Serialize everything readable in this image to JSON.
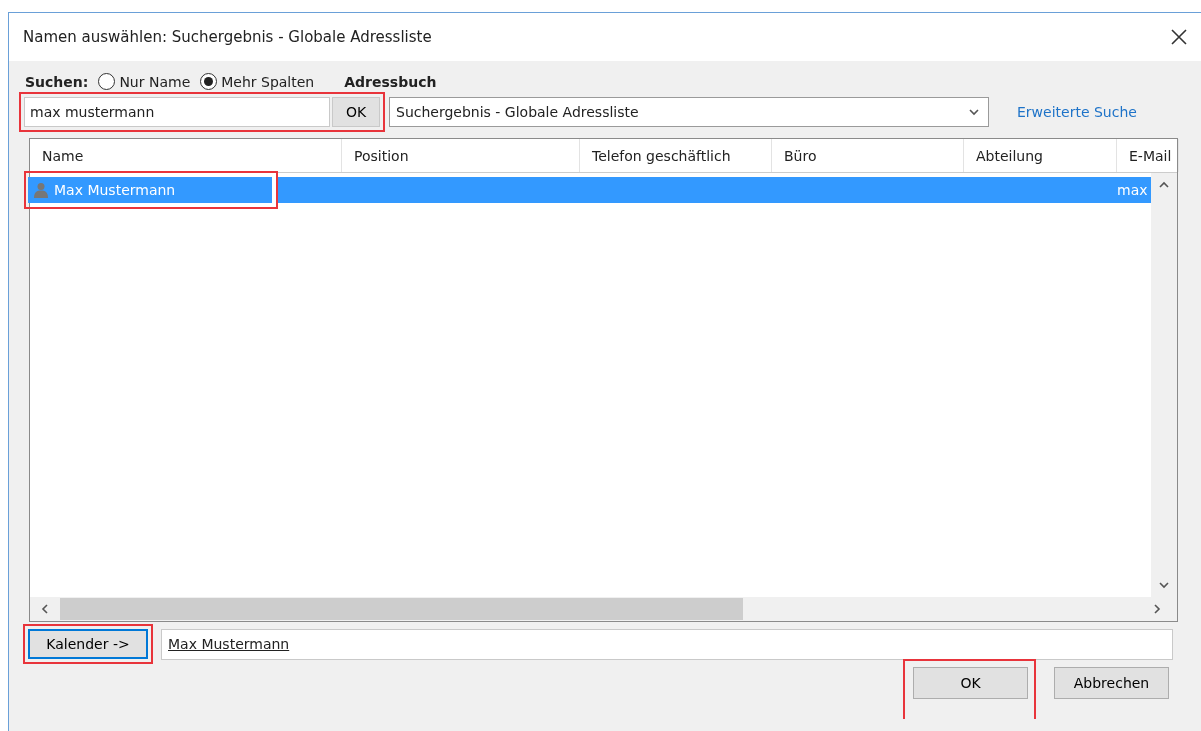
{
  "window": {
    "title": "Namen auswählen: Suchergebnis - Globale Adressliste"
  },
  "search": {
    "label": "Suchen:",
    "options": [
      {
        "label": "Nur Name",
        "selected": false
      },
      {
        "label": "Mehr Spalten",
        "selected": true
      }
    ],
    "value": "max mustermann",
    "ok_button": "OK",
    "highlighted": true
  },
  "address_book": {
    "label": "Adressbuch",
    "value": "Suchergebnis - Globale Adressliste",
    "link": "Erweiterte Suche"
  },
  "table": {
    "columns": [
      "Name",
      "Position",
      "Telefon geschäftlich",
      "Büro",
      "Abteilung",
      "E-Mail"
    ],
    "rows": [
      {
        "cells": [
          "Max Mustermann",
          "",
          "",
          "",
          "",
          "max"
        ],
        "selected": true,
        "highlighted": true
      }
    ]
  },
  "calendar": {
    "button": "Kalender ->",
    "value": "Max Mustermann",
    "highlighted": true
  },
  "buttons": [
    {
      "label": "OK",
      "highlighted": true
    },
    {
      "label": "Abbrechen",
      "highlighted": false
    }
  ]
}
